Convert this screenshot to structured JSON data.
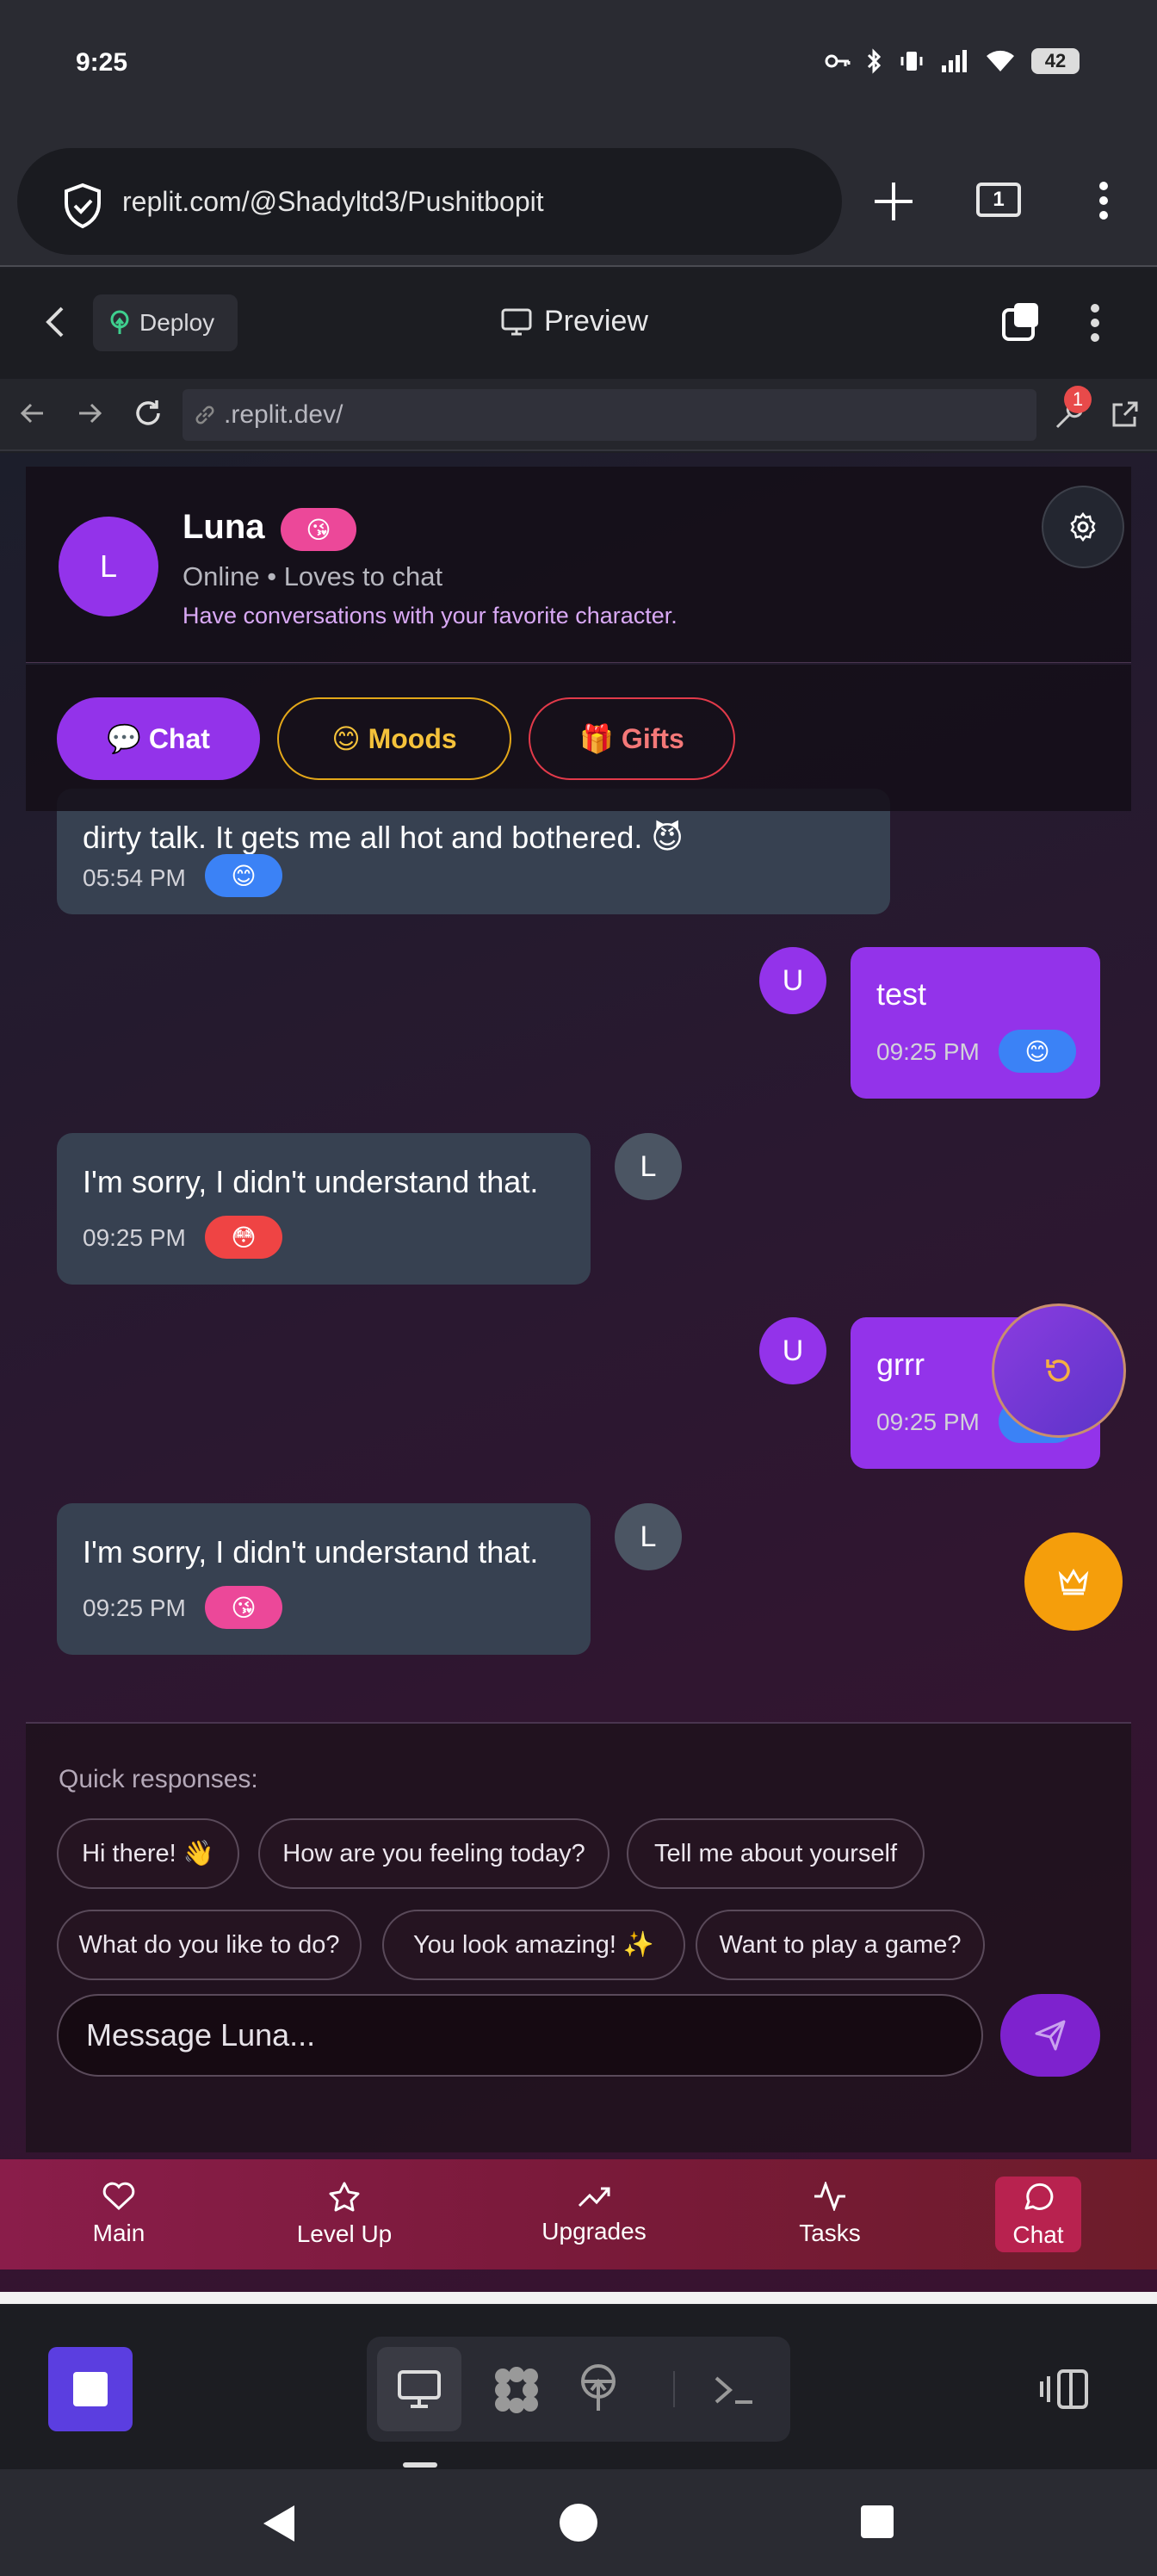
{
  "status_bar": {
    "time": "9:25",
    "battery": "42"
  },
  "browser": {
    "url": "replit.com/@Shadyltd3/Pushitbopit",
    "tab_count": "1"
  },
  "replit": {
    "deploy_label": "Deploy",
    "preview_label": "Preview",
    "address": ".replit.dev/",
    "wrench_badge": "1"
  },
  "character": {
    "avatar_initial": "L",
    "name": "Luna",
    "badge_emoji": "😘",
    "status": "Online • Loves to chat",
    "description": "Have conversations with your favorite character."
  },
  "tabs": [
    {
      "label": "💬 Chat"
    },
    {
      "label": "😊 Moods"
    },
    {
      "label": "🎁 Gifts"
    }
  ],
  "messages": [
    {
      "from": "luna",
      "text": "dirty talk. It gets me all hot and bothered. 😈",
      "time": "05:54 PM",
      "mood": "😊",
      "mood_color": "#3b82f6"
    },
    {
      "from": "user",
      "avatar": "U",
      "text": "test",
      "time": "09:25 PM",
      "mood": "😊",
      "mood_color": "#3b82f6"
    },
    {
      "from": "luna",
      "avatar": "L",
      "text": "I'm sorry, I didn't understand that.",
      "time": "09:25 PM",
      "mood": "😳",
      "mood_color": "#ef4444"
    },
    {
      "from": "user",
      "avatar": "U",
      "text": "grrr",
      "time": "09:25 PM",
      "mood": "😊",
      "mood_color": "#3b82f6"
    },
    {
      "from": "luna",
      "avatar": "L",
      "text": "I'm sorry, I didn't understand that.",
      "time": "09:25 PM",
      "mood": "😘",
      "mood_color": "#ec4899"
    }
  ],
  "quick": {
    "label": "Quick responses:",
    "chips": [
      "Hi there! 👋",
      "How are you feeling today?",
      "Tell me about yourself",
      "What do you like to do?",
      "You look amazing! ✨",
      "Want to play a game?"
    ]
  },
  "input": {
    "placeholder": "Message Luna..."
  },
  "app_nav": [
    {
      "label": "Main",
      "icon": "heart-icon"
    },
    {
      "label": "Level Up",
      "icon": "star-icon"
    },
    {
      "label": "Upgrades",
      "icon": "trending-up-icon"
    },
    {
      "label": "Tasks",
      "icon": "activity-icon"
    },
    {
      "label": "Chat",
      "icon": "message-circle-icon",
      "active": true
    }
  ],
  "colors": {
    "accent": "#9333ea",
    "luna_bubble": "#374151",
    "nav_bar": "#8a1d4a",
    "crown": "#f59e0b"
  }
}
